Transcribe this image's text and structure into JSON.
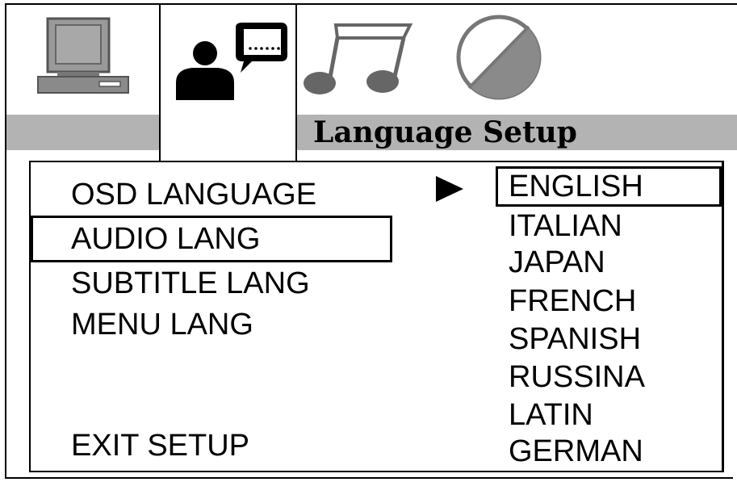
{
  "header": {
    "title": "Language Setup"
  },
  "tabs": [
    {
      "icon": "monitor-icon"
    },
    {
      "icon": "person-speech-icon"
    },
    {
      "icon": "music-note-icon"
    },
    {
      "icon": "disc-icon"
    }
  ],
  "menu": {
    "items": [
      {
        "label": "OSD LANGUAGE"
      },
      {
        "label": "AUDIO LANG"
      },
      {
        "label": "SUBTITLE LANG"
      },
      {
        "label": "MENU LANG"
      }
    ],
    "exit_label": "EXIT SETUP"
  },
  "options": {
    "selected_marker": "▶",
    "items": [
      {
        "label": "ENGLISH"
      },
      {
        "label": "ITALIAN"
      },
      {
        "label": "JAPAN"
      },
      {
        "label": "FRENCH"
      },
      {
        "label": "SPANISH"
      },
      {
        "label": "RUSSINA"
      },
      {
        "label": "LATIN"
      },
      {
        "label": "GERMAN"
      }
    ]
  }
}
